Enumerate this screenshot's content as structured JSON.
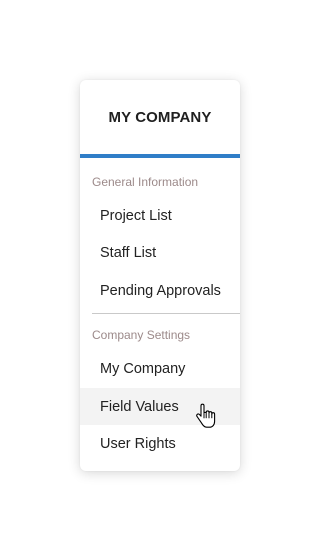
{
  "menu": {
    "title": "MY COMPANY",
    "accent_color": "#2f7ec8",
    "sections": [
      {
        "label": "General Information",
        "items": [
          "Project List",
          "Staff List",
          "Pending Approvals"
        ]
      },
      {
        "label": "Company Settings",
        "items": [
          "My Company",
          "Field Values",
          "User Rights"
        ]
      }
    ],
    "hovered_item": "Field Values"
  },
  "cursor": {
    "type": "hand-pointer-icon"
  }
}
